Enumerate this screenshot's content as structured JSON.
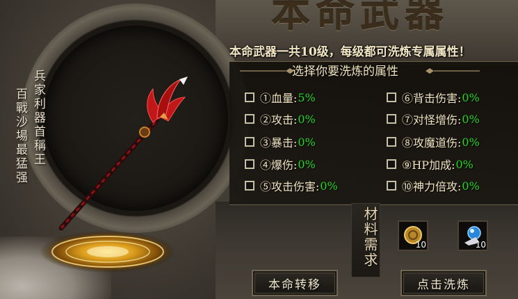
{
  "header": {
    "big_title": "本命武器",
    "subtitle": "本命武器一共10级，每级都可洗炼专属属性！",
    "select_title": "选择你要洗炼的属性"
  },
  "weapon_panel": {
    "vertical_right": "兵家利器首稱王",
    "vertical_left": "百戰沙場最猛强"
  },
  "attributes": {
    "left": [
      {
        "label": "①血量:",
        "value": "5%"
      },
      {
        "label": "②攻击:",
        "value": "0%"
      },
      {
        "label": "③暴击:",
        "value": "0%"
      },
      {
        "label": "④爆伤:",
        "value": "0%"
      },
      {
        "label": "⑤攻击伤害:",
        "value": "0%"
      }
    ],
    "right": [
      {
        "label": "⑥背击伤害:",
        "value": "0%"
      },
      {
        "label": "⑦对怪增伤:",
        "value": "0%"
      },
      {
        "label": "⑧攻魔道伤:",
        "value": "0%"
      },
      {
        "label": "⑨HP加成:",
        "value": "0%"
      },
      {
        "label": "⑩神力倍攻:",
        "value": "0%"
      }
    ]
  },
  "materials": {
    "label": "材料需求",
    "items": [
      {
        "icon": "gold-coin-item-icon",
        "count": "10"
      },
      {
        "icon": "blue-gem-item-icon",
        "count": "10"
      }
    ]
  },
  "buttons": {
    "transfer": "本命转移",
    "refine": "点击洗炼"
  },
  "colors": {
    "value_green": "#22d820",
    "label_text": "#efe3c2"
  }
}
